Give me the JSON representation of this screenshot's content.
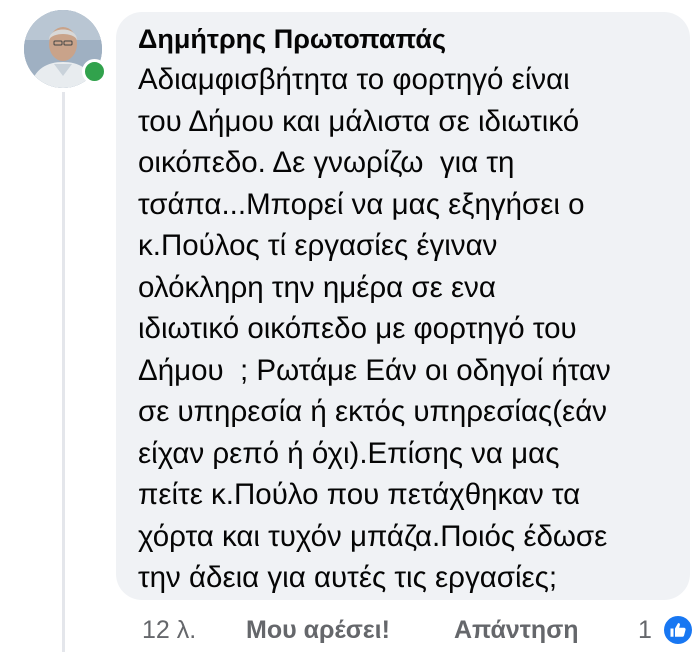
{
  "comment": {
    "author": "Δημήτρης Πρωτοπαπάς",
    "author_status": "online",
    "text_lines": [
      "Αδιαμφισβήτητα το φορτηγό είναι",
      "του Δήμου και μάλιστα σε ιδιωτικό",
      "οικόπεδο. Δε γνωρίζω  για τη",
      "τσάπα...Μπορεί να μας εξηγήσει ο",
      "κ.Πούλος τί εργασίες έγιναν",
      "ολόκληρη την ημέρα σε ενα",
      "ιδιωτικό οικόπεδο με φορτηγό του",
      "Δήμου  ; Ρωτάμε Εάν οι οδηγοί ήταν",
      "σε υπηρεσία ή εκτός υπηρεσίας(εάν",
      "είχαν ρεπό ή όχι).Επίσης να μας",
      "πείτε κ.Πούλο που πετάχθηκαν τα",
      "χόρτα και τυχόν μπάζα.Ποιός έδωσε",
      "την άδεια για αυτές τις εργασίες;"
    ]
  },
  "actions": {
    "time": "12 λ.",
    "like_label": "Μου αρέσει!",
    "reply_label": "Απάντηση",
    "reaction_count": "1",
    "reaction_icon": "thumbs-up-icon"
  },
  "colors": {
    "bubble": "#f0f2f5",
    "text": "#050505",
    "meta": "#65676b",
    "online": "#31a24c",
    "like_blue": "#1877f2"
  }
}
